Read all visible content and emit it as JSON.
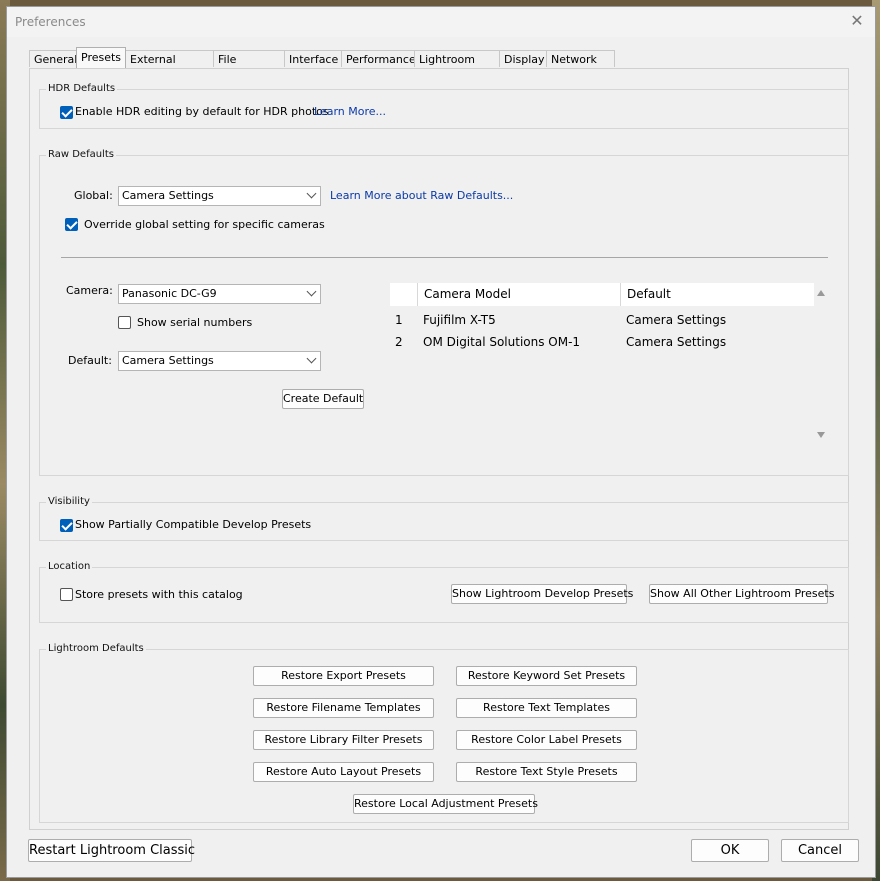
{
  "window": {
    "title": "Preferences"
  },
  "tabs": [
    {
      "label": "General"
    },
    {
      "label": "Presets"
    },
    {
      "label": "External Editing"
    },
    {
      "label": "File Handling"
    },
    {
      "label": "Interface"
    },
    {
      "label": "Performance"
    },
    {
      "label": "Lightroom Sync"
    },
    {
      "label": "Display"
    },
    {
      "label": "Network"
    }
  ],
  "hdr": {
    "title": "HDR Defaults",
    "enable_label": "Enable HDR editing by default for HDR photos",
    "enable_checked": true,
    "learn_more": "Learn More..."
  },
  "raw": {
    "title": "Raw Defaults",
    "global_label": "Global:",
    "global_value": "Camera Settings",
    "learn_more": "Learn More about Raw Defaults...",
    "override_label": "Override global setting for specific cameras",
    "override_checked": true,
    "camera_label": "Camera:",
    "camera_value": "Panasonic DC-G9",
    "serial_label": "Show serial numbers",
    "serial_checked": false,
    "default_label": "Default:",
    "default_value": "Camera Settings",
    "create_default": "Create Default",
    "table": {
      "headers": [
        "Camera Model",
        "Default"
      ],
      "rows": [
        {
          "num": "1",
          "model": "Fujifilm X-T5",
          "default": "Camera Settings"
        },
        {
          "num": "2",
          "model": "OM Digital Solutions OM-1",
          "default": "Camera Settings"
        }
      ]
    }
  },
  "visibility": {
    "title": "Visibility",
    "show_partial_label": "Show Partially Compatible Develop Presets",
    "show_partial_checked": true
  },
  "location": {
    "title": "Location",
    "store_label": "Store presets with this catalog",
    "store_checked": false,
    "show_develop": "Show Lightroom Develop Presets",
    "show_other": "Show All Other Lightroom Presets"
  },
  "defaults": {
    "title": "Lightroom Defaults",
    "buttons": [
      "Restore Export Presets",
      "Restore Keyword Set Presets",
      "Restore Filename Templates",
      "Restore Text Templates",
      "Restore Library Filter Presets",
      "Restore Color Label Presets",
      "Restore Auto Layout Presets",
      "Restore Text Style Presets",
      "Restore Local Adjustment Presets"
    ]
  },
  "footer": {
    "restart": "Restart Lightroom Classic",
    "ok": "OK",
    "cancel": "Cancel"
  }
}
